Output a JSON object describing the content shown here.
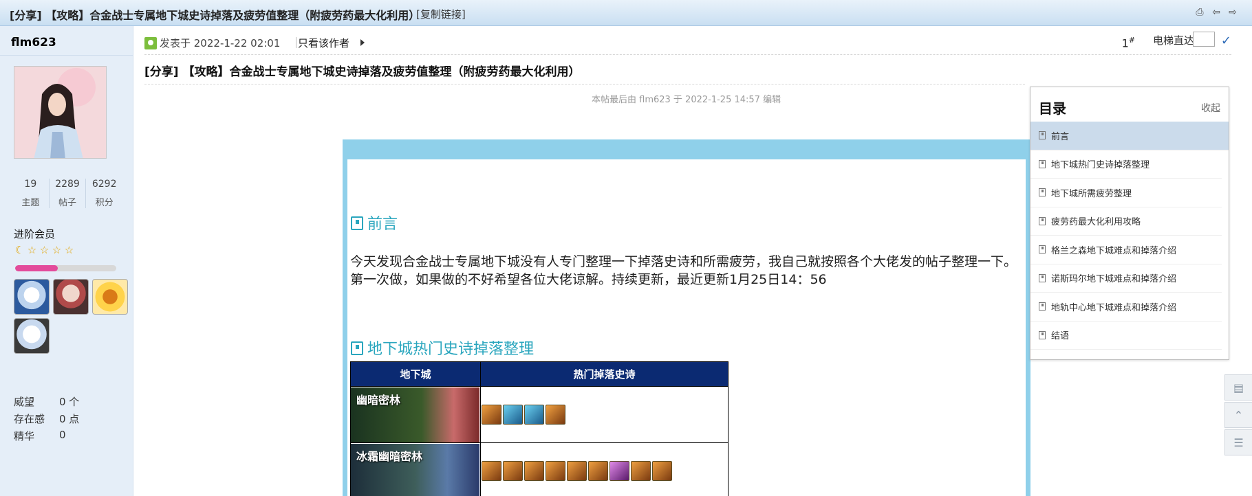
{
  "topbar": {
    "title": "[分享] 【攻略】合金战士专属地下城史诗掉落及疲劳值整理（附疲劳药最大化利用）",
    "copy_link": "[复制链接]",
    "icons": [
      "print-icon",
      "prev-icon",
      "next-icon"
    ]
  },
  "author": {
    "name": "flm623",
    "stats": [
      {
        "num": "19",
        "label": "主题"
      },
      {
        "num": "2289",
        "label": "帖子"
      },
      {
        "num": "6292",
        "label": "积分"
      }
    ],
    "group": "进阶会员",
    "level_progress": 0.42,
    "info": [
      {
        "k": "威望",
        "v": "0 个"
      },
      {
        "k": "存在感",
        "v": "0 点"
      },
      {
        "k": "精华",
        "v": "0"
      }
    ]
  },
  "post": {
    "posted": "发表于 2022-1-22 02:01",
    "author_only": "只看该作者",
    "floor": "1",
    "floor_sup": "#",
    "elevator": "电梯直达",
    "title": "[分享] 【攻略】合金战士专属地下城史诗掉落及疲劳值整理（附疲劳药最大化利用）",
    "edit_note": "本帖最后由 flm623 于 2022-1-25 14:57 编辑",
    "sections": {
      "preface": "前言",
      "drops": "地下城热门史诗掉落整理"
    },
    "paragraph_line1": "今天发现合金战士专属地下城没有人专门整理一下掉落史诗和所需疲劳，我自己就按照各个大佬发的帖子整理一下。",
    "paragraph_line2": "第一次做，如果做的不好希望各位大佬谅解。持续更新，最近更新1月25日14：56",
    "table": {
      "headers": [
        "地下城",
        "热门掉落史诗"
      ],
      "rows": [
        {
          "dungeon": "幽暗密林",
          "gear": [
            "o",
            "b",
            "b",
            "o"
          ]
        },
        {
          "dungeon": "冰霜幽暗密林",
          "gear": [
            "o",
            "o",
            "o",
            "o",
            "o",
            "o",
            "p",
            "o",
            "o"
          ]
        }
      ]
    }
  },
  "toc": {
    "title": "目录",
    "collapse": "收起",
    "items": [
      "前言",
      "地下城热门史诗掉落整理",
      "地下城所需疲劳整理",
      "疲劳药最大化利用攻略",
      "格兰之森地下城难点和掉落介绍",
      "诺斯玛尔地下城难点和掉落介绍",
      "地轨中心地下城难点和掉落介绍",
      "结语"
    ],
    "active_index": 0
  },
  "float_tools": [
    "comment-icon",
    "back-to-top-icon",
    "list-icon"
  ]
}
